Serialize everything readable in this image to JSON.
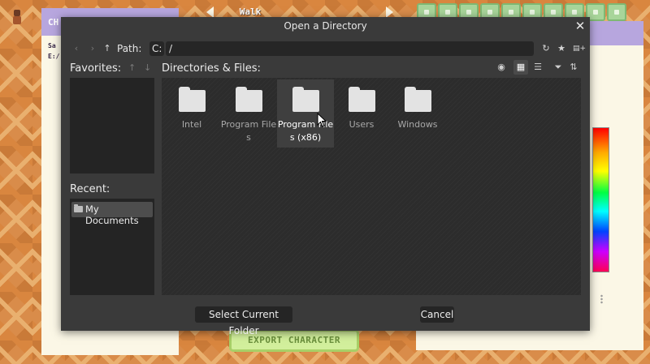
{
  "background_app": {
    "left_panel": {
      "header_title": "CH",
      "line1": "Sa",
      "line2": "E:/"
    },
    "walk_label": "Walk",
    "export_button": "EXPORT CHARACTER",
    "toolbar_tools": [
      "tool-1",
      "tool-2",
      "tool-3",
      "tool-4",
      "tool-5",
      "tool-6",
      "tool-7",
      "tool-8",
      "tool-9",
      "tool-10"
    ]
  },
  "dialog": {
    "title": "Open a Directory",
    "close_glyph": "✕",
    "path_label": "Path:",
    "drive": "C:",
    "path_value": "/",
    "favorites_label": "Favorites:",
    "recent_label": "Recent:",
    "recent_items": [
      "My Documents"
    ],
    "files_label": "Directories & Files:",
    "items": [
      {
        "name": "Intel",
        "selected": false
      },
      {
        "name": "Program Files",
        "selected": false
      },
      {
        "name": "Program Files (x86)",
        "selected": true
      },
      {
        "name": "Users",
        "selected": false
      },
      {
        "name": "Windows",
        "selected": false
      }
    ],
    "select_button": "Select Current Folder",
    "cancel_button": "Cancel",
    "icons": {
      "back": "‹",
      "forward": "›",
      "up": "↑",
      "refresh": "↻",
      "favorite": "★",
      "new_folder": "▤+",
      "show_hidden": "◉",
      "grid_view": "▦",
      "list_view": "☰",
      "filter": "⏷",
      "sort": "⇅",
      "fav_up": "↑",
      "fav_down": "↓"
    },
    "colors": {
      "background": "#3a3a3a",
      "panel": "#242424",
      "selected": "#3f3f3f",
      "folder": "#e3e3e3"
    }
  }
}
